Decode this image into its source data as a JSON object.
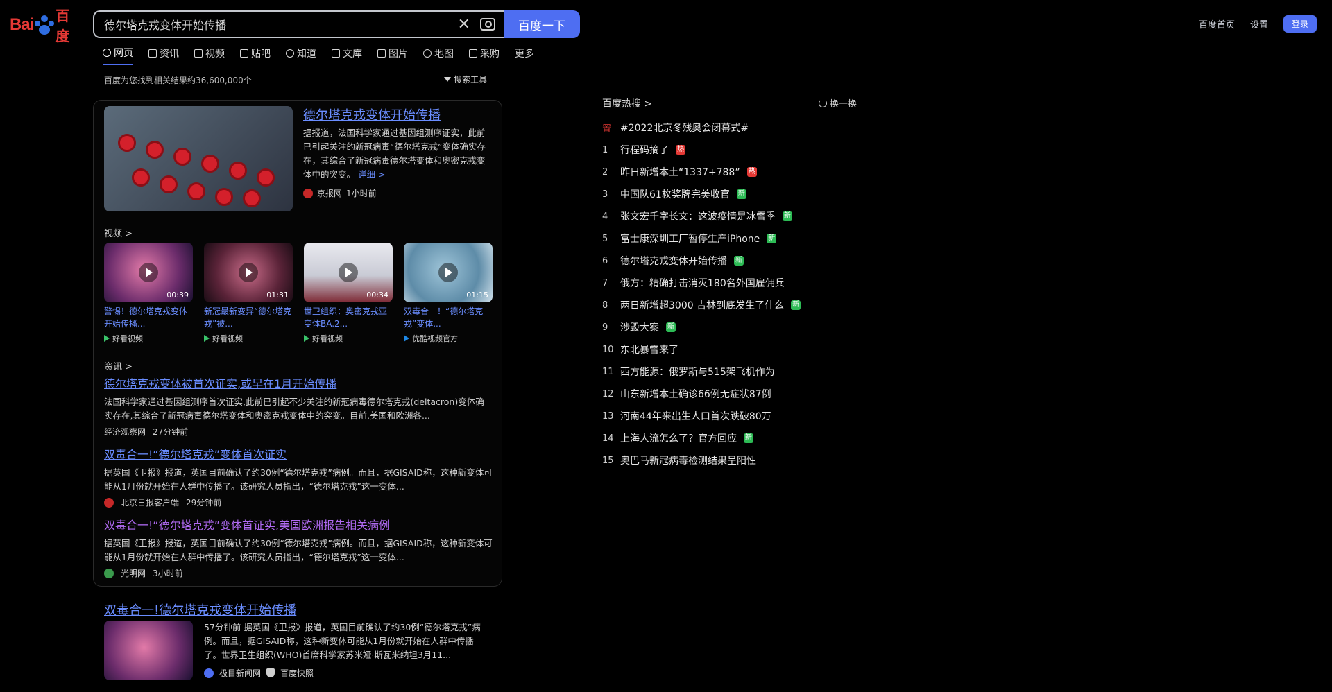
{
  "header": {
    "logo_text_left": "Bai",
    "logo_text_right": "百度",
    "search_value": "德尔塔克戎变体开始传播",
    "search_button": "百度一下",
    "links": [
      "百度首页",
      "设置"
    ],
    "login": "登录"
  },
  "tabs": [
    {
      "label": "网页"
    },
    {
      "label": "资讯"
    },
    {
      "label": "视频"
    },
    {
      "label": "贴吧"
    },
    {
      "label": "知道"
    },
    {
      "label": "文库"
    },
    {
      "label": "图片"
    },
    {
      "label": "地图"
    },
    {
      "label": "采购"
    },
    {
      "label": "更多"
    }
  ],
  "result_count": "百度为您找到相关结果约36,600,000个",
  "search_tools": "搜索工具",
  "top_result": {
    "title": "德尔塔克戎变体开始传播",
    "desc": "据报道，法国科学家通过基因组测序证实，此前已引起关注的新冠病毒“德尔塔克戎”变体确实存在，其综合了新冠病毒德尔塔变体和奥密克戎变体中的突变。",
    "more": "详细 >",
    "source": "京报网",
    "time": "1小时前"
  },
  "video_section_label": "视频 >",
  "videos": [
    {
      "title": "警惕！德尔塔克戎变体开始传播...",
      "duration": "00:39",
      "source": "好看视频"
    },
    {
      "title": "新冠最新变异“德尔塔克戎”被...",
      "duration": "01:31",
      "source": "好看视频"
    },
    {
      "title": "世卫组织：奥密克戎亚变体BA.2...",
      "duration": "00:34",
      "source": "好看视频"
    },
    {
      "title": "双毒合一！“德尔塔克戎”变体...",
      "duration": "01:15",
      "source": "优酷视频官方"
    }
  ],
  "news_section_label": "资讯 >",
  "news": [
    {
      "title": "德尔塔克戎变体被首次证实,或早在1月开始传播",
      "desc": "法国科学家通过基因组测序首次证实,此前已引起不少关注的新冠病毒德尔塔克戎(deltacron)变体确实存在,其综合了新冠病毒德尔塔变体和奥密克戎变体中的突变。目前,美国和欧洲各...",
      "source": "经济观察网",
      "time": "27分钟前",
      "visited": false
    },
    {
      "title": "双毒合一!“德尔塔克戎”变体首次证实",
      "desc": "据英国《卫报》报道，英国目前确认了约30例“德尔塔克戎”病例。而且，据GISAID称，这种新变体可能从1月份就开始在人群中传播了。该研究人员指出，“德尔塔克戎”这一变体...",
      "source": "北京日报客户端",
      "time": "29分钟前",
      "visited": false
    },
    {
      "title": "双毒合一!“德尔塔克戎”变体首证实,美国欧洲报告相关病例",
      "desc": "据英国《卫报》报道，英国目前确认了约30例“德尔塔克戎”病例。而且，据GISAID称，这种新变体可能从1月份就开始在人群中传播了。该研究人员指出，“德尔塔克戎”这一变体...",
      "source": "光明网",
      "time": "3小时前",
      "visited": true
    }
  ],
  "bottom_result": {
    "title": "双毒合一!德尔塔克戎变体开始传播",
    "desc_time": "57分钟前",
    "desc": "据英国《卫报》报道，英国目前确认了约30例“德尔塔克戎”病例。而且，据GISAID称，这种新变体可能从1月份就开始在人群中传播了。世界卫生组织(WHO)首席科学家苏米娅·斯瓦米纳坦3月11...",
    "source": "极目新闻网",
    "source2": "百度快照"
  },
  "hotlist": {
    "title": "百度热搜 >",
    "refresh": "换一换",
    "items": [
      {
        "rank": "置",
        "text": "#2022北京冬残奥会闭幕式#",
        "tag": ""
      },
      {
        "rank": "1",
        "text": "行程码摘了",
        "tag": "热"
      },
      {
        "rank": "2",
        "text": "昨日新增本土“1337+788”",
        "tag": "热"
      },
      {
        "rank": "3",
        "text": "中国队61枚奖牌完美收官",
        "tag": "新"
      },
      {
        "rank": "4",
        "text": "张文宏千字长文：这波疫情是冰雪季",
        "tag": "新"
      },
      {
        "rank": "5",
        "text": "富士康深圳工厂暂停生产iPhone",
        "tag": "新"
      },
      {
        "rank": "6",
        "text": "德尔塔克戎变体开始传播",
        "tag": "新"
      },
      {
        "rank": "7",
        "text": "俄方：精确打击消灭180名外国雇佣兵",
        "tag": ""
      },
      {
        "rank": "8",
        "text": "两日新增超3000 吉林到底发生了什么",
        "tag": "新"
      },
      {
        "rank": "9",
        "text": "涉毁大案",
        "tag": "新"
      },
      {
        "rank": "10",
        "text": "东北暴雪来了",
        "tag": ""
      },
      {
        "rank": "11",
        "text": "西方能源：俄罗斯与515架飞机作为",
        "tag": ""
      },
      {
        "rank": "12",
        "text": "山东新增本土确诊66例无症状87例",
        "tag": ""
      },
      {
        "rank": "13",
        "text": "河南44年来出生人口首次跌破80万",
        "tag": ""
      },
      {
        "rank": "14",
        "text": "上海人流怎么了？官方回应",
        "tag": "新"
      },
      {
        "rank": "15",
        "text": "奥巴马新冠病毒检测结果呈阳性",
        "tag": ""
      }
    ]
  }
}
